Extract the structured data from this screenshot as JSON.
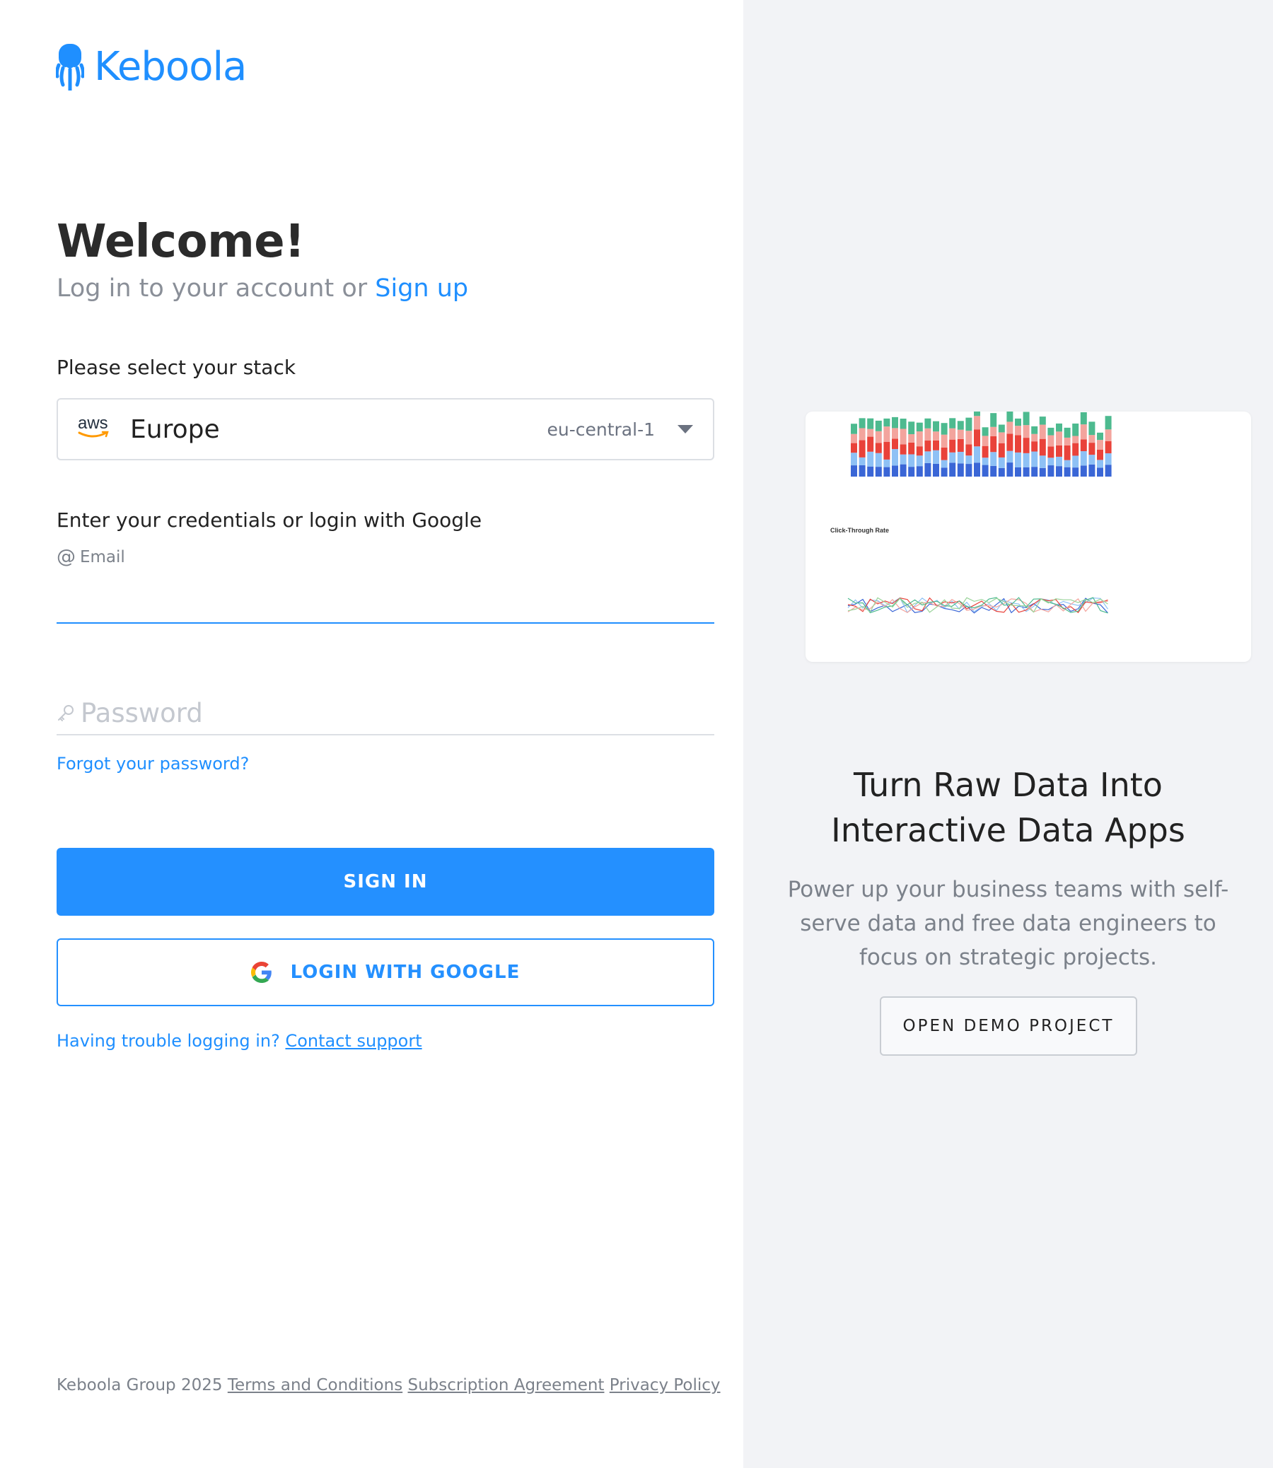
{
  "brand": {
    "name": "Keboola",
    "color": "#1f8fff"
  },
  "login": {
    "title": "Welcome!",
    "subtitle": "Log in to your account or",
    "signup_link": "Sign up",
    "stack_label": "Please select your stack",
    "stack": {
      "provider_icon": "aws-logo",
      "provider_text": "aws",
      "name": "Europe",
      "region": "eu-central-1"
    },
    "credentials_label": "Enter your credentials or login with Google",
    "email_label": "Email",
    "email_value": "",
    "password_placeholder": "Password",
    "forgot_password": "Forgot your password?",
    "sign_in": "SIGN IN",
    "google_login": "LOGIN WITH GOOGLE",
    "trouble_text": "Having trouble logging in?",
    "contact_support": "Contact support"
  },
  "footer": {
    "copyright": "Keboola Group 2025",
    "links": [
      "Terms and Conditions",
      "Subscription Agreement",
      "Privacy Policy"
    ]
  },
  "promo": {
    "preview_chart_title": "Click-Through Rate",
    "title_line1": "Turn Raw Data Into",
    "title_line2": "Interactive Data Apps",
    "description": "Power up your business teams with self-serve data and free data engineers to focus on strategic projects.",
    "demo_button": "OPEN DEMO PROJECT"
  },
  "colors": {
    "accent": "#2490ff",
    "right_panel_bg": "#f2f3f6",
    "muted_text": "#7b818a"
  }
}
